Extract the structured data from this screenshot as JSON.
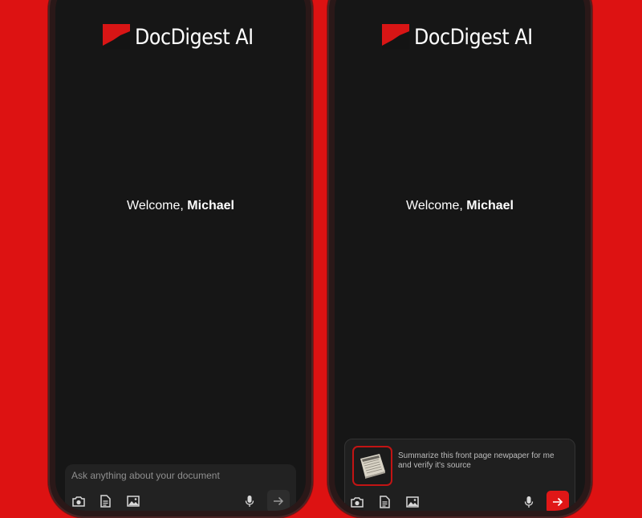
{
  "brand": {
    "name": "DocDigest AI",
    "accent": "#dd1212"
  },
  "screens": [
    {
      "welcome_prefix": "Welcome,",
      "user_name": "Michael",
      "composer": {
        "placeholder": "Ask anything about your document",
        "icons": [
          "camera-icon",
          "document-icon",
          "image-icon",
          "microphone-icon",
          "send-arrow-icon"
        ],
        "send_active": false
      }
    },
    {
      "welcome_prefix": "Welcome,",
      "user_name": "Michael",
      "composer": {
        "attachment": "newspaper-thumbnail",
        "message": "Summarize this front page newpaper for me and verify it's source",
        "icons": [
          "camera-icon",
          "document-icon",
          "image-icon",
          "microphone-icon",
          "send-arrow-icon"
        ],
        "send_active": true
      }
    }
  ]
}
